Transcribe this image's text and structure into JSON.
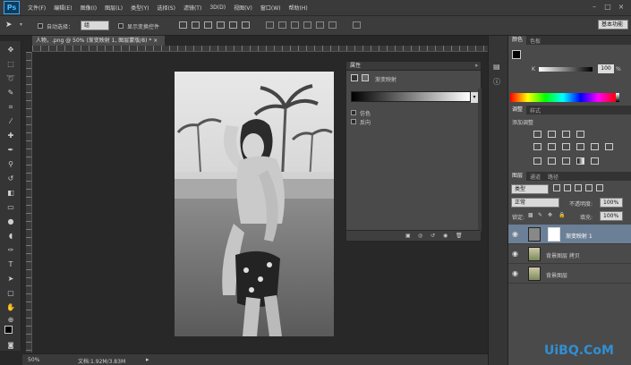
{
  "app": {
    "logo": "Ps"
  },
  "menu": [
    "文件(F)",
    "编辑(E)",
    "图像(I)",
    "图层(L)",
    "类型(Y)",
    "选择(S)",
    "滤镜(T)",
    "3D(D)",
    "视图(V)",
    "窗口(W)",
    "帮助(H)"
  ],
  "window_controls": [
    "–",
    "□",
    "×"
  ],
  "options": {
    "auto_select_label": "自动选择：",
    "auto_select_value": "组",
    "show_transform_label": "显示变换控件",
    "workspace": "基本功能"
  },
  "document": {
    "tab_title": "人物，.png @ 50% (渐变映射 1, 图层蒙版/8) * ×",
    "zoom": "50%",
    "doc_info": "文档:1.92M/3.83M"
  },
  "properties": {
    "title": "属性",
    "adjustment_name": "渐变映射",
    "dither_label": "仿色",
    "reverse_label": "反向"
  },
  "color_panel": {
    "tabs": [
      "颜色",
      "色板"
    ],
    "channel": "K",
    "value": "100",
    "unit": "%"
  },
  "adjustments_panel": {
    "tabs": [
      "调整",
      "样式"
    ],
    "heading": "添加调整"
  },
  "layers_panel": {
    "tabs": [
      "图层",
      "通道",
      "路径"
    ],
    "filter_kind": "类型",
    "blend_mode": "正常",
    "opacity_label": "不透明度:",
    "opacity_value": "100%",
    "lock_label": "锁定:",
    "fill_label": "填充:",
    "fill_value": "100%",
    "layers": [
      {
        "name": "渐变映射 1",
        "selected": true
      },
      {
        "name": "背景图层 拷贝",
        "selected": false
      },
      {
        "name": "背景图层",
        "selected": false
      }
    ]
  },
  "watermark": {
    "text": "UiBQ.CoM"
  },
  "colors": {
    "accent_selected": "#6b7f96",
    "ps_blue": "#3fa9f5"
  }
}
